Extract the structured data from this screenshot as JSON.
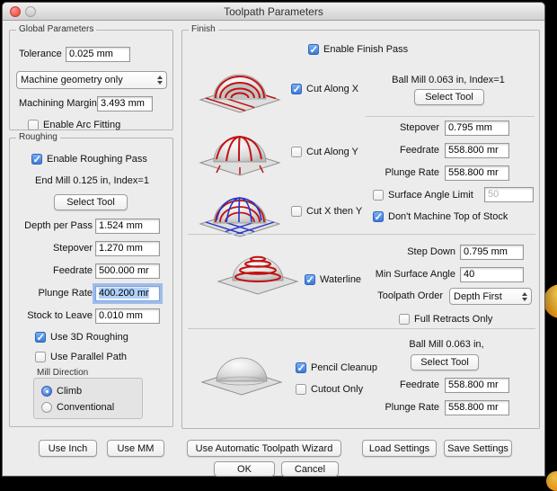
{
  "window": {
    "title": "Toolpath Parameters"
  },
  "global": {
    "legend": "Global Parameters",
    "tolerance_label": "Tolerance",
    "tolerance_value": "0.025 mm",
    "geometry_value": "Machine geometry only",
    "margin_label": "Machining Margin",
    "margin_value": "3.493 mm",
    "arc_fitting_label": "Enable Arc Fitting"
  },
  "roughing": {
    "legend": "Roughing",
    "enable_label": "Enable Roughing Pass",
    "tool_desc": "End Mill 0.125 in, Index=1",
    "select_tool_label": "Select Tool",
    "depth_label": "Depth per Pass",
    "depth_value": "1.524 mm",
    "stepover_label": "Stepover",
    "stepover_value": "1.270 mm",
    "feedrate_label": "Feedrate",
    "feedrate_value": "500.000 mr",
    "plunge_label": "Plunge Rate",
    "plunge_value": "400.200 mr",
    "stock_label": "Stock to Leave",
    "stock_value": "0.010 mm",
    "use3d_label": "Use 3D Roughing",
    "parallel_label": "Use Parallel Path",
    "milldir_legend": "Mill Direction",
    "climb_label": "Climb",
    "conventional_label": "Conventional"
  },
  "finish": {
    "legend": "Finish",
    "enable_label": "Enable Finish Pass",
    "cutx_label": "Cut Along X",
    "cuty_label": "Cut Along Y",
    "cutxy_label": "Cut X then Y",
    "tool_desc": "Ball Mill 0.063 in, Index=1",
    "select_tool_label": "Select Tool",
    "stepover_label": "Stepover",
    "stepover_value": "0.795 mm",
    "feedrate_label": "Feedrate",
    "feedrate_value": "558.800 mr",
    "plunge_label": "Plunge Rate",
    "plunge_value": "558.800 mr",
    "surface_angle_label": "Surface Angle Limit",
    "surface_angle_value": "50",
    "no_top_label": "Don't Machine Top of Stock",
    "waterline_label": "Waterline",
    "stepdown_label": "Step Down",
    "stepdown_value": "0.795 mm",
    "min_angle_label": "Min Surface Angle",
    "min_angle_value": "40",
    "order_label": "Toolpath Order",
    "order_value": "Depth First",
    "retracts_label": "Full Retracts Only",
    "pencil_label": "Pencil Cleanup",
    "cutout_label": "Cutout Only",
    "cleanup_tool_desc": "Ball Mill 0.063 in,",
    "cleanup_select_tool_label": "Select Tool",
    "cleanup_feedrate_label": "Feedrate",
    "cleanup_feedrate_value": "558.800 mr",
    "cleanup_plunge_label": "Plunge Rate",
    "cleanup_plunge_value": "558.800 mr"
  },
  "footer": {
    "use_inch": "Use Inch",
    "use_mm": "Use MM",
    "wizard": "Use Automatic Toolpath Wizard",
    "load": "Load Settings",
    "save": "Save Settings",
    "ok": "OK",
    "cancel": "Cancel"
  },
  "states": {
    "arc_fitting": false,
    "roughing_enabled": true,
    "use_3d_roughing": true,
    "use_parallel_path": false,
    "mill_climb": true,
    "mill_conventional": false,
    "finish_enabled": true,
    "cut_along_x": true,
    "cut_along_y": false,
    "cut_x_then_y": false,
    "surface_angle_limit": false,
    "dont_machine_top": true,
    "waterline": true,
    "full_retracts_only": false,
    "pencil_cleanup": true,
    "cutout_only": false
  },
  "colors": {
    "accent": "#3a79d8",
    "selection": "#b0d0f8",
    "toolpath_red": "#c11212",
    "toolpath_blue": "#2233cc"
  }
}
